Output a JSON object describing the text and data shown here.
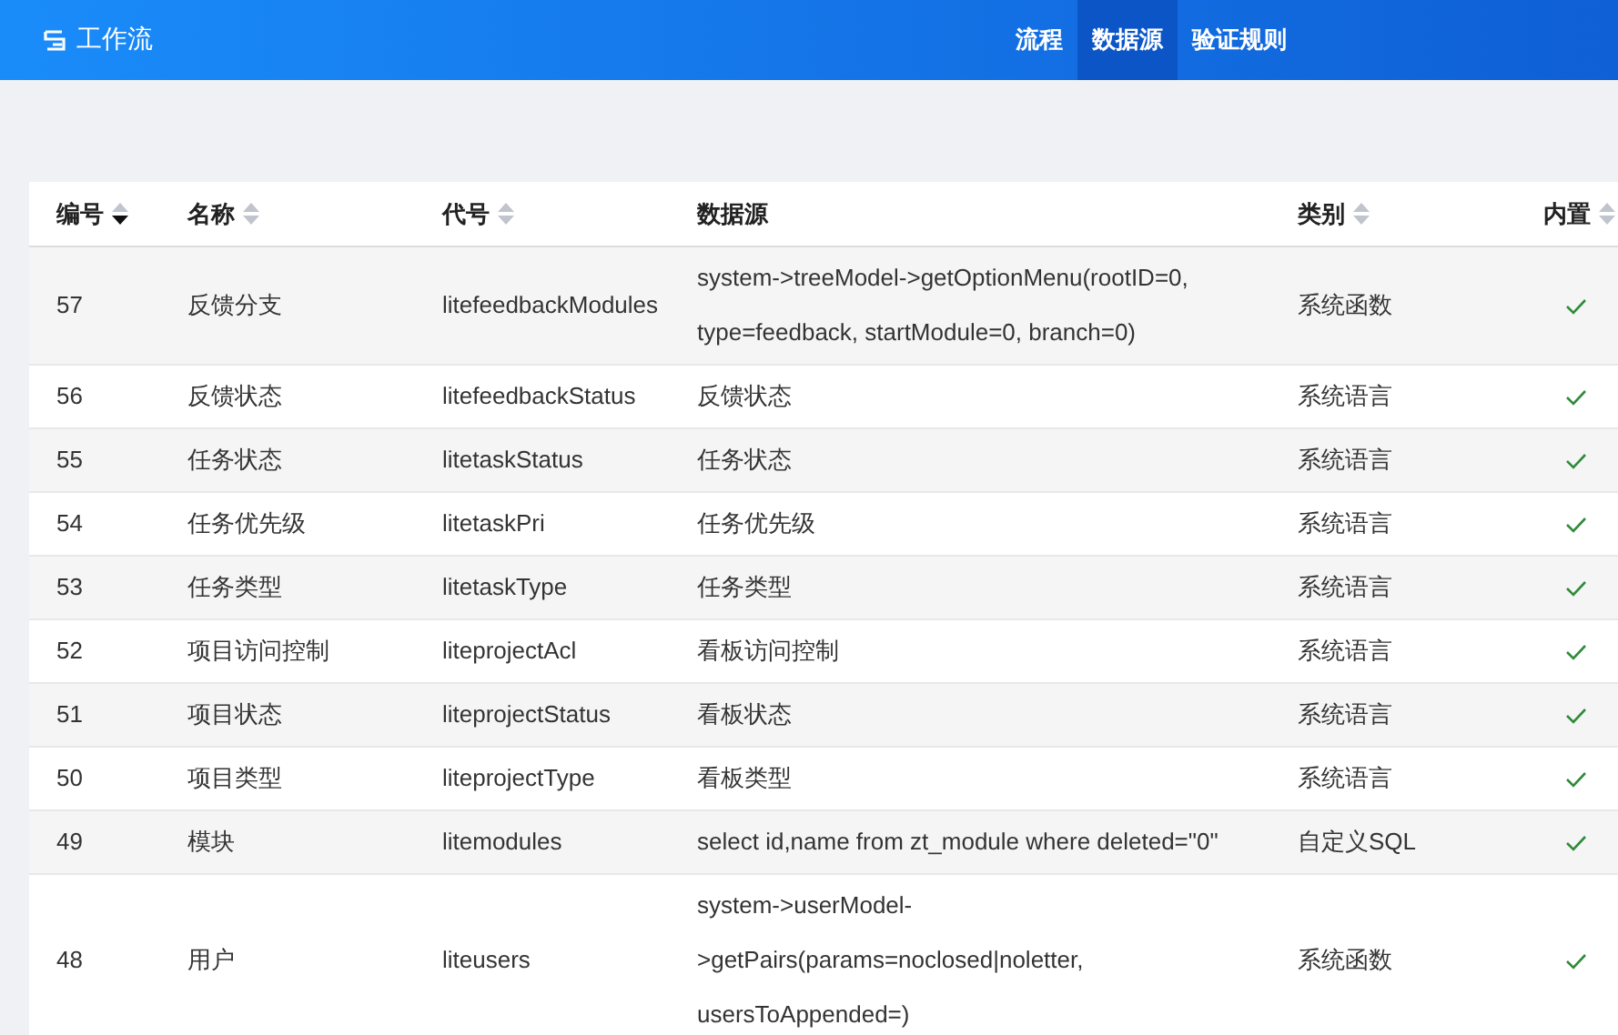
{
  "app": {
    "title": "工作流"
  },
  "nav": [
    {
      "label": "流程",
      "selected": false
    },
    {
      "label": "数据源",
      "selected": true
    },
    {
      "label": "验证规则",
      "selected": false
    }
  ],
  "table": {
    "columns": [
      {
        "label": "编号",
        "sortable": true,
        "sorted_descending": true
      },
      {
        "label": "名称",
        "sortable": true,
        "sorted_descending": false
      },
      {
        "label": "代号",
        "sortable": true,
        "sorted_descending": false
      },
      {
        "label": "数据源"
      },
      {
        "label": "类别",
        "sortable": true,
        "sorted_descending": false
      },
      {
        "label": "内置",
        "sortable": true,
        "sorted_descending": false
      }
    ],
    "rows": [
      {
        "id": "57",
        "name": "反馈分支",
        "code": "litefeedbackModules",
        "source": "system->treeModel->getOptionMenu(rootID=0, type=feedback, startModule=0, branch=0)",
        "type": "系统函数",
        "builtin": true
      },
      {
        "id": "56",
        "name": "反馈状态",
        "code": "litefeedbackStatus",
        "source": "反馈状态",
        "type": "系统语言",
        "builtin": true
      },
      {
        "id": "55",
        "name": "任务状态",
        "code": "litetaskStatus",
        "source": "任务状态",
        "type": "系统语言",
        "builtin": true
      },
      {
        "id": "54",
        "name": "任务优先级",
        "code": "litetaskPri",
        "source": "任务优先级",
        "type": "系统语言",
        "builtin": true
      },
      {
        "id": "53",
        "name": "任务类型",
        "code": "litetaskType",
        "source": "任务类型",
        "type": "系统语言",
        "builtin": true
      },
      {
        "id": "52",
        "name": "项目访问控制",
        "code": "liteprojectAcl",
        "source": "看板访问控制",
        "type": "系统语言",
        "builtin": true
      },
      {
        "id": "51",
        "name": "项目状态",
        "code": "liteprojectStatus",
        "source": "看板状态",
        "type": "系统语言",
        "builtin": true
      },
      {
        "id": "50",
        "name": "项目类型",
        "code": "liteprojectType",
        "source": "看板类型",
        "type": "系统语言",
        "builtin": true
      },
      {
        "id": "49",
        "name": "模块",
        "code": "litemodules",
        "source": "select id,name from zt_module where deleted=\"0\"",
        "type": "自定义SQL",
        "builtin": true
      },
      {
        "id": "48",
        "name": "用户",
        "code": "liteusers",
        "source": "system->userModel->getPairs(params=noclosed|noletter, usersToAppended=)",
        "type": "系统函数",
        "builtin": true
      }
    ]
  }
}
